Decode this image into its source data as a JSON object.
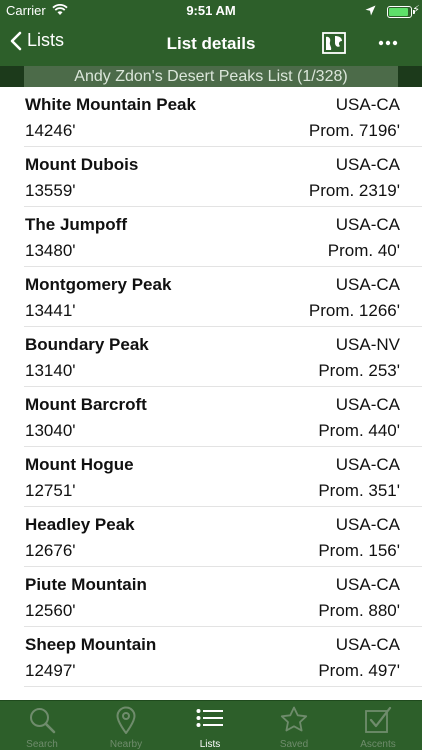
{
  "status": {
    "carrier": "Carrier",
    "time": "9:51 AM",
    "battery_level": 0.9
  },
  "nav": {
    "back_label": "Lists",
    "title": "List details"
  },
  "section_header": "Andy Zdon's Desert Peaks List (1/328)",
  "peaks": [
    {
      "name": "White Mountain Peak",
      "region": "USA-CA",
      "elevation": "14246'",
      "prominence": "Prom. 7196'"
    },
    {
      "name": "Mount Dubois",
      "region": "USA-CA",
      "elevation": "13559'",
      "prominence": "Prom. 2319'"
    },
    {
      "name": "The Jumpoff",
      "region": "USA-CA",
      "elevation": "13480'",
      "prominence": "Prom. 40'"
    },
    {
      "name": "Montgomery Peak",
      "region": "USA-CA",
      "elevation": "13441'",
      "prominence": "Prom. 1266'"
    },
    {
      "name": "Boundary Peak",
      "region": "USA-NV",
      "elevation": "13140'",
      "prominence": "Prom. 253'"
    },
    {
      "name": "Mount Barcroft",
      "region": "USA-CA",
      "elevation": "13040'",
      "prominence": "Prom. 440'"
    },
    {
      "name": "Mount Hogue",
      "region": "USA-CA",
      "elevation": "12751'",
      "prominence": "Prom. 351'"
    },
    {
      "name": "Headley Peak",
      "region": "USA-CA",
      "elevation": "12676'",
      "prominence": "Prom. 156'"
    },
    {
      "name": "Piute Mountain",
      "region": "USA-CA",
      "elevation": "12560'",
      "prominence": "Prom. 880'"
    },
    {
      "name": "Sheep Mountain",
      "region": "USA-CA",
      "elevation": "12497'",
      "prominence": "Prom. 497'"
    }
  ],
  "tabs": [
    {
      "label": "Search",
      "icon": "search-icon"
    },
    {
      "label": "Nearby",
      "icon": "location-pin-icon"
    },
    {
      "label": "Lists",
      "icon": "list-icon",
      "active": true
    },
    {
      "label": "Saved",
      "icon": "star-icon"
    },
    {
      "label": "Ascents",
      "icon": "checkbox-icon"
    }
  ],
  "colors": {
    "bar_green": "#2d5f2a",
    "header_green": "#4c6b49",
    "tab_inactive": "#6f8c6c",
    "tab_active": "#ffffff"
  }
}
